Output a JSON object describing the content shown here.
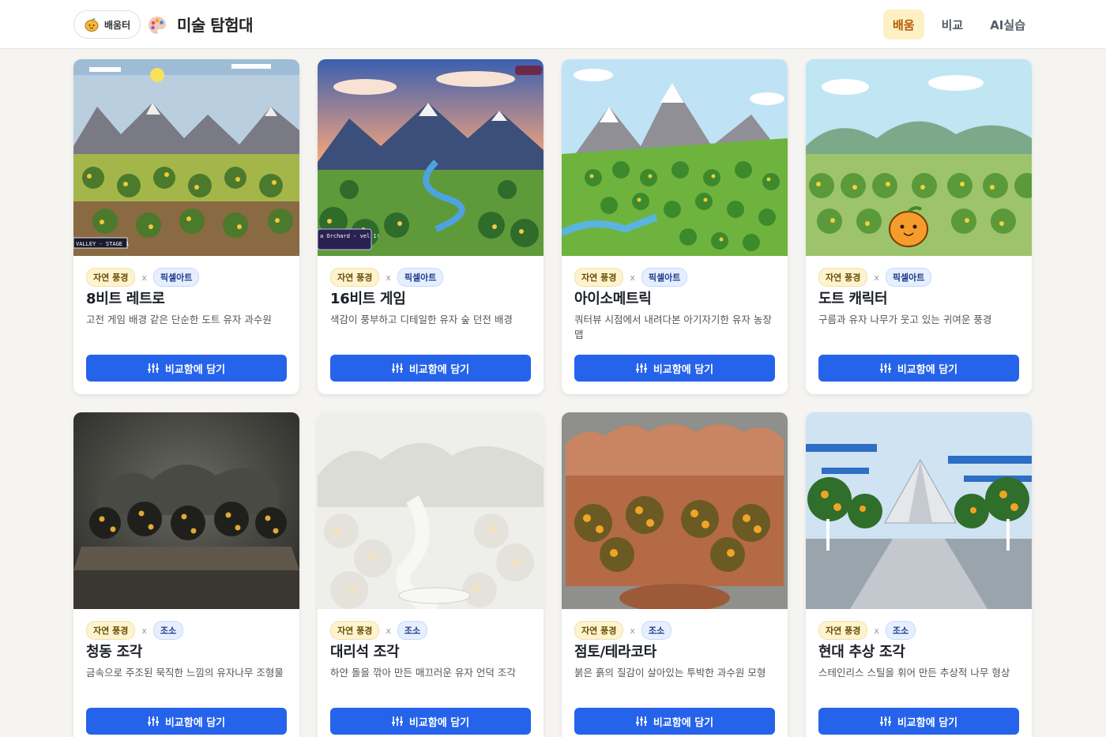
{
  "header": {
    "home_label": "배움터",
    "title": "미술 탐험대",
    "nav": [
      {
        "label": "배움",
        "active": true
      },
      {
        "label": "비교",
        "active": false
      },
      {
        "label": "AI실습",
        "active": false
      }
    ]
  },
  "compare_button_label": "비교함에 담기",
  "separator": "x",
  "cards": [
    {
      "tag_nature": "자연 풍경",
      "tag_style": "픽셀아트",
      "title": "8비트 레트로",
      "desc": "고전 게임 배경 같은 단순한 도트 유자 과수원",
      "image": "8bit-orchard-image",
      "image_text": "VALLEY - STAGE 1"
    },
    {
      "tag_nature": "자연 풍경",
      "tag_style": "픽셀아트",
      "title": "16비트 게임",
      "desc": "색감이 풍부하고 디테일한 유자 숲 던전 배경",
      "image": "16bit-valley-image",
      "image_text": "a Orchard - vel 1!"
    },
    {
      "tag_nature": "자연 풍경",
      "tag_style": "픽셀아트",
      "title": "아이소메트릭",
      "desc": "쿼터뷰 시점에서 내려다본 아기자기한 유자 농장 맵",
      "image": "isometric-farm-image"
    },
    {
      "tag_nature": "자연 풍경",
      "tag_style": "픽셀아트",
      "title": "도트 캐릭터",
      "desc": "구름과 유자 나무가 웃고 있는 귀여운 풍경",
      "image": "dot-character-image"
    },
    {
      "tag_nature": "자연 풍경",
      "tag_style": "조소",
      "title": "청동 조각",
      "desc": "금속으로 주조된 묵직한 느낌의 유자나무 조형물",
      "image": "bronze-sculpture-image"
    },
    {
      "tag_nature": "자연 풍경",
      "tag_style": "조소",
      "title": "대리석 조각",
      "desc": "하얀 돌을 깎아 만든 매끄러운 유자 언덕 조각",
      "image": "marble-sculpture-image"
    },
    {
      "tag_nature": "자연 풍경",
      "tag_style": "조소",
      "title": "점토/테라코타",
      "desc": "붉은 흙의 질감이 살아있는 투박한 과수원 모형",
      "image": "terracotta-image"
    },
    {
      "tag_nature": "자연 풍경",
      "tag_style": "조소",
      "title": "현대 추상 조각",
      "desc": "스테인리스 스틸을 휘어 만든 추상적 나무 형상",
      "image": "abstract-steel-image"
    }
  ]
}
